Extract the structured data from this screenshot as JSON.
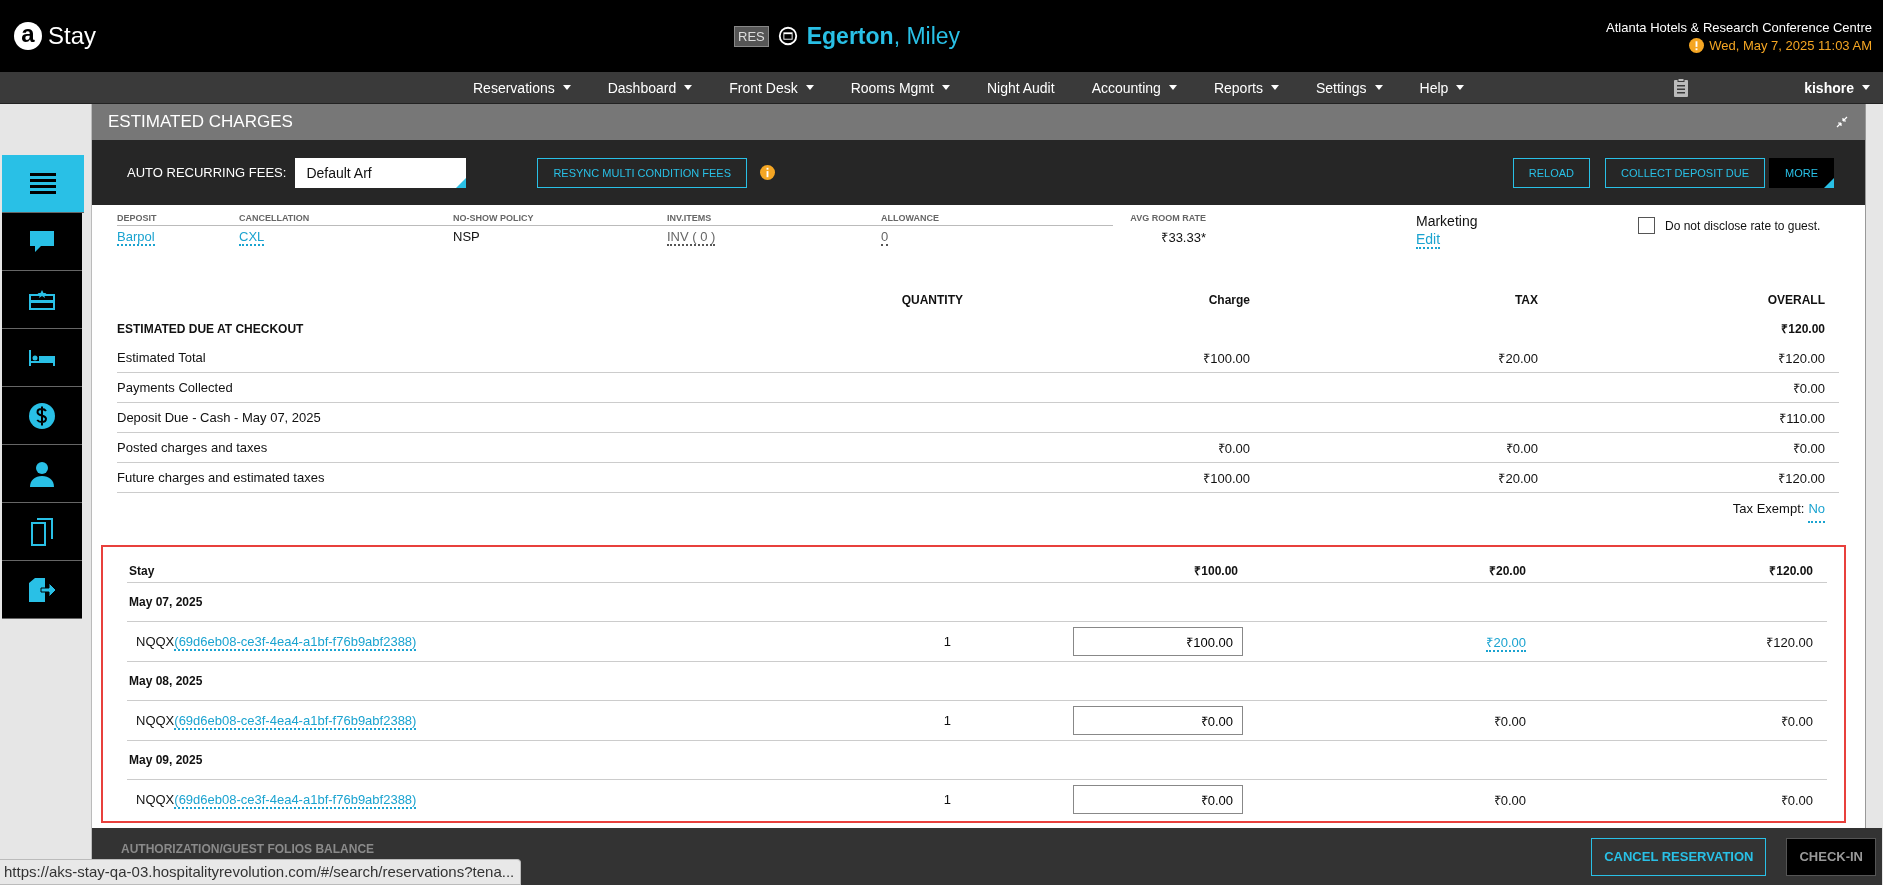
{
  "header": {
    "logo_mark": "a",
    "app_name": "Stay",
    "badge": "RES",
    "guest_last": "Egerton",
    "guest_first": ", Miley",
    "property": "Atlanta Hotels & Research Conference Centre",
    "datetime": "Wed, May 7, 2025 11:03 AM"
  },
  "nav": [
    {
      "label": "Reservations",
      "dropdown": true
    },
    {
      "label": "Dashboard",
      "dropdown": true
    },
    {
      "label": "Front Desk",
      "dropdown": true
    },
    {
      "label": "Rooms Mgmt",
      "dropdown": true
    },
    {
      "label": "Night Audit",
      "dropdown": false
    },
    {
      "label": "Accounting",
      "dropdown": true
    },
    {
      "label": "Reports",
      "dropdown": true
    },
    {
      "label": "Settings",
      "dropdown": true
    },
    {
      "label": "Help",
      "dropdown": true
    }
  ],
  "user": {
    "name": "kishore"
  },
  "sidebar": [
    {
      "kind": "menu",
      "selected": true
    },
    {
      "kind": "chat",
      "selected": false
    },
    {
      "kind": "card",
      "selected": false
    },
    {
      "kind": "bed",
      "selected": false
    },
    {
      "kind": "dollar",
      "selected": false
    },
    {
      "kind": "person",
      "selected": false
    },
    {
      "kind": "documents",
      "selected": false
    },
    {
      "kind": "export",
      "selected": false
    }
  ],
  "panel": {
    "title": "ESTIMATED CHARGES"
  },
  "toolbar": {
    "arf_label": "AUTO RECURRING FEES:",
    "arf_value": "Default Arf",
    "resync": "RESYNC MULTI CONDITION FEES",
    "buttons": [
      "RELOAD",
      "COLLECT DEPOSIT DUE"
    ],
    "more": "MORE"
  },
  "policies": [
    {
      "label": "DEPOSIT",
      "value": "Barpol",
      "kind": "link"
    },
    {
      "label": "CANCELLATION",
      "value": "CXL",
      "kind": "link"
    },
    {
      "label": "NO-SHOW POLICY",
      "value": "NSP",
      "kind": "text"
    },
    {
      "label": "INV.ITEMS",
      "value": "INV ( 0 )",
      "kind": "muted"
    },
    {
      "label": "ALLOWANCE",
      "value": "0",
      "kind": "muted"
    },
    {
      "label": "AVG ROOM RATE",
      "value": "₹33.33*",
      "kind": "rate"
    }
  ],
  "marketing": {
    "label": "Marketing",
    "link": "Edit"
  },
  "disclose": {
    "label": "Do not disclose rate to guest.",
    "checked": false
  },
  "table": {
    "columns": [
      "QUANTITY",
      "Charge",
      "TAX",
      "OVERALL"
    ],
    "section_title": "ESTIMATED DUE AT CHECKOUT",
    "section_total": "₹120.00",
    "rows": [
      {
        "label": "Estimated Total",
        "charge": "₹100.00",
        "tax": "₹20.00",
        "overall": "₹120.00"
      },
      {
        "label": "Payments Collected",
        "overall": "₹0.00"
      },
      {
        "label": "Deposit Due - Cash - May 07, 2025",
        "overall": "₹110.00"
      },
      {
        "label": "Posted charges and taxes",
        "charge": "₹0.00",
        "tax": "₹0.00",
        "overall": "₹0.00"
      },
      {
        "label": "Future charges and estimated taxes",
        "charge": "₹100.00",
        "tax": "₹20.00",
        "overall": "₹120.00"
      }
    ]
  },
  "tax_exempt": {
    "label": "Tax Exempt:",
    "value": "No"
  },
  "stay": {
    "title": "Stay",
    "charge": "₹100.00",
    "tax": "₹20.00",
    "overall": "₹120.00",
    "days": [
      {
        "date": "May 07, 2025",
        "items": [
          {
            "code": "NQQX",
            "ref": "(69d6eb08-ce3f-4ea4-a1bf-f76b9abf2388)",
            "quantity": "1",
            "charge": "₹100.00",
            "tax": "₹20.00",
            "tax_link": true,
            "overall": "₹120.00"
          }
        ]
      },
      {
        "date": "May 08, 2025",
        "items": [
          {
            "code": "NQQX",
            "ref": "(69d6eb08-ce3f-4ea4-a1bf-f76b9abf2388)",
            "quantity": "1",
            "charge": "₹0.00",
            "tax": "₹0.00",
            "tax_link": false,
            "overall": "₹0.00"
          }
        ]
      },
      {
        "date": "May 09, 2025",
        "items": [
          {
            "code": "NQQX",
            "ref": "(69d6eb08-ce3f-4ea4-a1bf-f76b9abf2388)",
            "quantity": "1",
            "charge": "₹0.00",
            "tax": "₹0.00",
            "tax_link": false,
            "overall": "₹0.00"
          }
        ]
      }
    ]
  },
  "footer": {
    "section": "AUTHORIZATION/GUEST FOLIOS BALANCE",
    "buttons": [
      {
        "label": "CANCEL RESERVATION",
        "disabled": false
      },
      {
        "label": "CHECK-IN",
        "disabled": true
      }
    ]
  },
  "status_url": "https://aks-stay-qa-03.hospitalityrevolution.com/#/search/reservations?tena..."
}
